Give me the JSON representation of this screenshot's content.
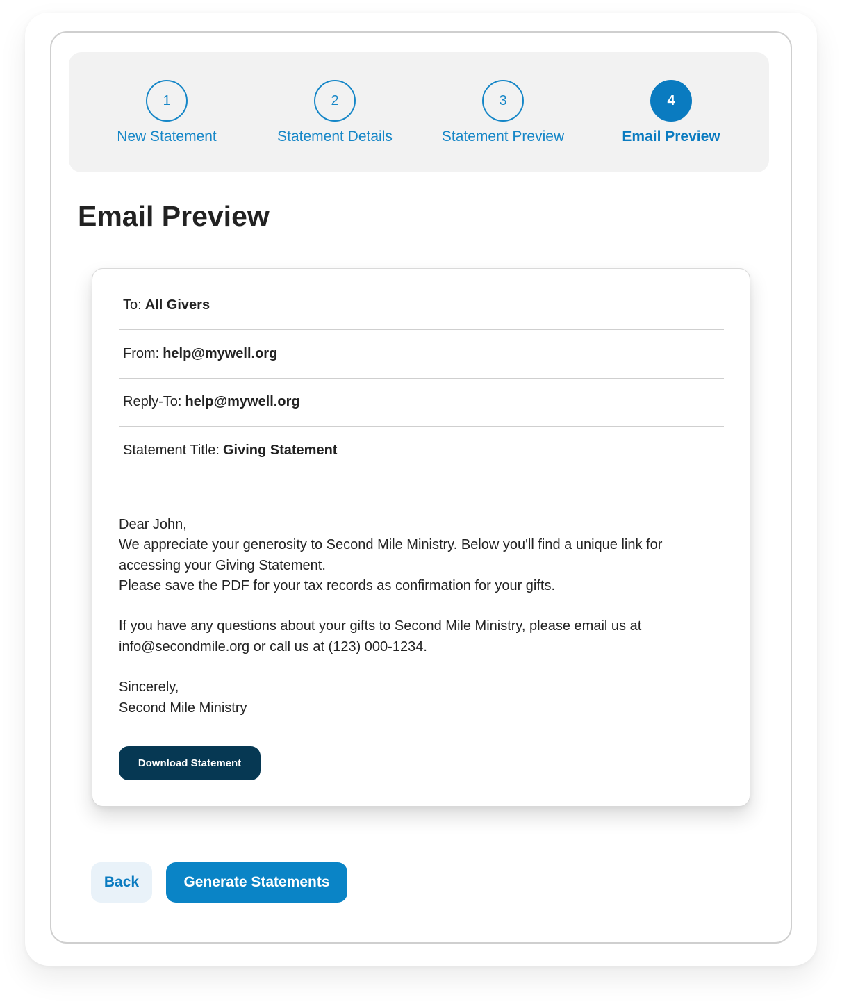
{
  "stepper": {
    "steps": [
      {
        "number": "1",
        "label": "New Statement"
      },
      {
        "number": "2",
        "label": "Statement Details"
      },
      {
        "number": "3",
        "label": "Statement Preview"
      },
      {
        "number": "4",
        "label": "Email Preview"
      }
    ],
    "active_step": 4
  },
  "page_title": "Email Preview",
  "email": {
    "to_label": "To:",
    "to_value": "All Givers",
    "from_label": "From:",
    "from_value": "help@mywell.org",
    "reply_to_label": "Reply-To:",
    "reply_to_value": "help@mywell.org",
    "statement_title_label": "Statement Title:",
    "statement_title_value": "Giving Statement",
    "greeting": "Dear John,",
    "paragraph_1": "We appreciate your generosity to Second Mile Ministry. Below you'll find a unique link for accessing your Giving Statement.",
    "paragraph_2": "Please save the PDF for your tax records as confirmation for your gifts.",
    "paragraph_3": "If you have any questions about your gifts to Second Mile Ministry, please email us at info@secondmile.org or call us at (123) 000-1234.",
    "closing": "Sincerely,",
    "signature": "Second Mile Ministry",
    "download_button": "Download Statement"
  },
  "actions": {
    "back_label": "Back",
    "generate_label": "Generate Statements"
  },
  "colors": {
    "accent": "#0a84c6",
    "step_active": "#0a7bc0",
    "download_button_bg": "#063853",
    "back_button_bg": "#e9f2f9",
    "stepper_bg": "#f2f2f2"
  }
}
